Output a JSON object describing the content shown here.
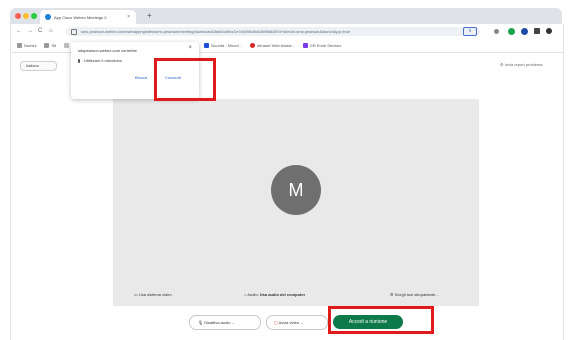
{
  "browser": {
    "tab_title": "App Cisco Webex Meetings X",
    "tab_close": "×",
    "new_tab": "+",
    "url": "sms.pearson.webex.com/webappng/sites/sms.pearson/meeting/download/1fa6b1d9bc1e7c6095cfbd1895b6d87a?siteurl=sms.pearson&launchApp=true",
    "nav_back": "←",
    "nav_forward": "→",
    "nav_reload": "C",
    "nav_home": "⌂",
    "bookmarks": [
      "Nomini",
      "Sit",
      "Ap...",
      "...dis",
      "Sicurità - Microf...",
      "Intranet Web Assist...",
      "GR Erste Servizio"
    ]
  },
  "popup": {
    "site": "sdspearson.webex.com vorrebbe",
    "close": "×",
    "permission": "Utilizzare il microfono",
    "block_label": "Blocca",
    "allow_label": "Consenti"
  },
  "page": {
    "language": "Italiano",
    "report": "Invia report problema"
  },
  "preview": {
    "avatar_initial": "M",
    "system_video": "Usa sistema video",
    "audio_label": "Audio:",
    "audio_value": "Usa audio del computer",
    "background": "Scegli tuoi altoparlante..."
  },
  "controls": {
    "mute_label": "Disattiva audio",
    "video_label": "Avvia video",
    "join_label": "Accedi a riunione"
  },
  "colors": {
    "join_green": "#0e7a4a",
    "highlight_red": "#e01a1a",
    "avatar_gray": "#6f6f6f"
  }
}
